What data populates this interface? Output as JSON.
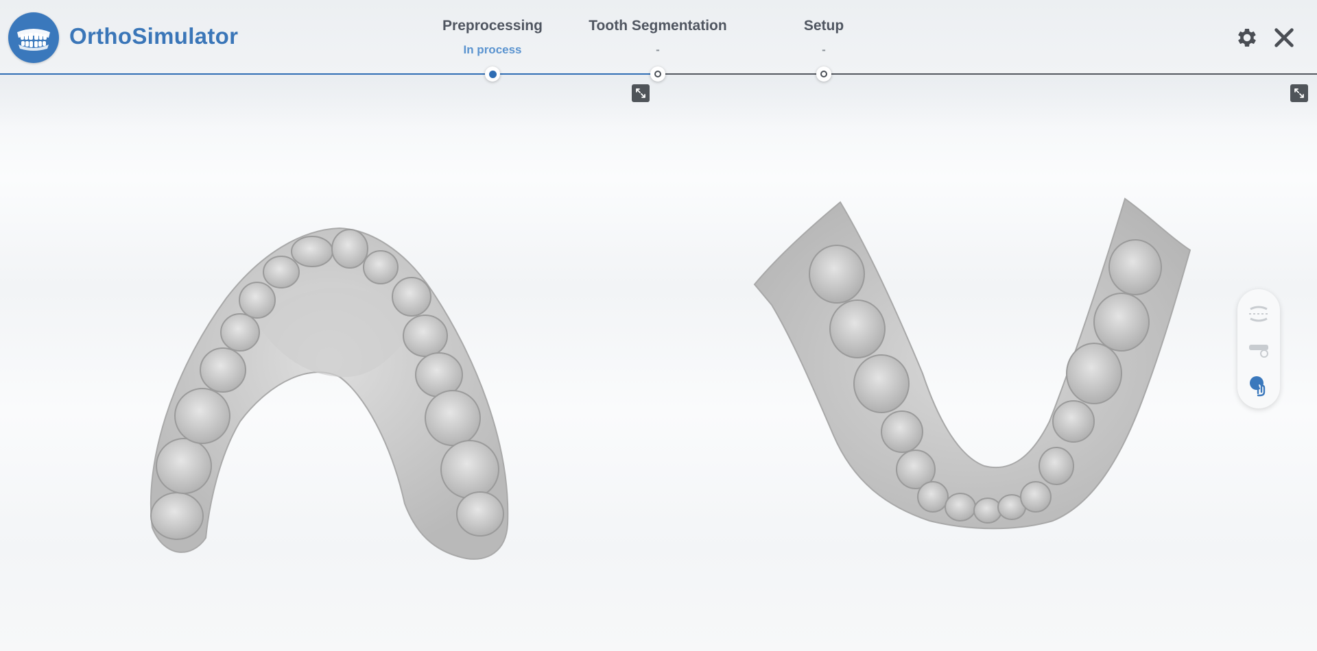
{
  "app": {
    "title": "OrthoSimulator"
  },
  "steps": [
    {
      "label": "Preprocessing",
      "status": "In process",
      "active": true
    },
    {
      "label": "Tooth Segmentation",
      "status": "-",
      "active": false
    },
    {
      "label": "Setup",
      "status": "-",
      "active": false
    }
  ],
  "colors": {
    "accent": "#3a78bc",
    "track_done": "#2e6db4",
    "track_pending": "#52575e",
    "model_gray": "#c4c4c4"
  },
  "icons": {
    "logo": "teeth-logo-icon",
    "settings": "gear-icon",
    "close": "close-icon",
    "expand": "expand-icon",
    "tools": [
      "occlusion-plane-icon",
      "gum-trim-icon",
      "touch-select-icon"
    ]
  },
  "viewports": [
    {
      "name": "upper-jaw"
    },
    {
      "name": "lower-jaw"
    }
  ]
}
